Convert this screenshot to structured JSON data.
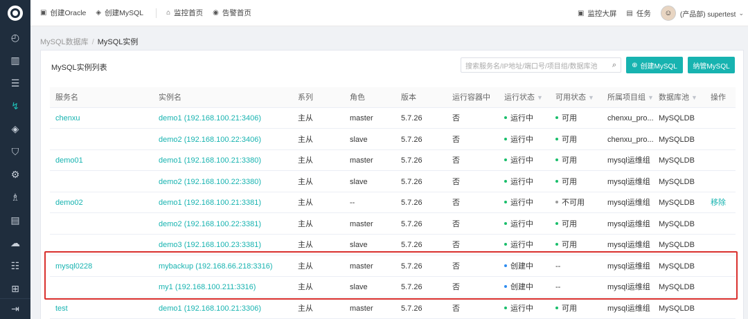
{
  "sidebar": {
    "items": [
      {
        "icon": "dashboard-icon",
        "glyph": "◴"
      },
      {
        "icon": "bar-chart-icon",
        "glyph": "▥"
      },
      {
        "icon": "database-icon",
        "glyph": "☰"
      },
      {
        "icon": "dolphin-icon",
        "glyph": "↯"
      },
      {
        "icon": "layers-icon",
        "glyph": "◈"
      },
      {
        "icon": "shield-icon",
        "glyph": "⛉"
      },
      {
        "icon": "gear-cluster-icon",
        "glyph": "⚙"
      },
      {
        "icon": "people-icon",
        "glyph": "♗"
      },
      {
        "icon": "server-icon",
        "glyph": "▤"
      },
      {
        "icon": "cloud-icon",
        "glyph": "☁"
      },
      {
        "icon": "list-icon",
        "glyph": "☷"
      },
      {
        "icon": "network-icon",
        "glyph": "⊞"
      }
    ],
    "active_index": 3,
    "bottom_icon": "logout-icon",
    "bottom_glyph": "⇥"
  },
  "topbar": {
    "create_oracle": "创建Oracle",
    "create_mysql": "创建MySQL",
    "monitor_home": "监控首页",
    "alert_home": "告警首页",
    "big_screen": "监控大屏",
    "tasks": "任务",
    "user": "(产品部) supertest"
  },
  "breadcrumb": {
    "parent": "MySQL数据库",
    "separator": "/",
    "current": "MySQL实例"
  },
  "card": {
    "title": "MySQL实例列表",
    "search_placeholder": "搜索服务名/IP地址/端口号/项目组/数据库池",
    "create_button": "创建MySQL",
    "manage_button": "纳管MySQL"
  },
  "table": {
    "headers": {
      "service": "服务名",
      "instance": "实例名",
      "series": "系列",
      "role": "角色",
      "version": "版本",
      "in_container": "运行容器中",
      "run_status": "运行状态",
      "avail_status": "可用状态",
      "project_group": "所属项目组",
      "db_pool": "数据库池",
      "action": "操作"
    },
    "rows": [
      {
        "service": "chenxu",
        "instance": "demo1 (192.168.100.21:3406)",
        "series": "主从",
        "role": "master",
        "version": "5.7.26",
        "in_container": "否",
        "run_status": "运行中",
        "avail_status": "可用",
        "project_group": "chenxu_pro...",
        "db_pool": "MySQLDB",
        "action": ""
      },
      {
        "service": "",
        "instance": "demo2 (192.168.100.22:3406)",
        "series": "主从",
        "role": "slave",
        "version": "5.7.26",
        "in_container": "否",
        "run_status": "运行中",
        "avail_status": "可用",
        "project_group": "chenxu_pro...",
        "db_pool": "MySQLDB",
        "action": ""
      },
      {
        "service": "demo01",
        "instance": "demo1 (192.168.100.21:3380)",
        "series": "主从",
        "role": "master",
        "version": "5.7.26",
        "in_container": "否",
        "run_status": "运行中",
        "avail_status": "可用",
        "project_group": "mysql运维组",
        "db_pool": "MySQLDB",
        "action": ""
      },
      {
        "service": "",
        "instance": "demo2 (192.168.100.22:3380)",
        "series": "主从",
        "role": "slave",
        "version": "5.7.26",
        "in_container": "否",
        "run_status": "运行中",
        "avail_status": "可用",
        "project_group": "mysql运维组",
        "db_pool": "MySQLDB",
        "action": ""
      },
      {
        "service": "demo02",
        "instance": "demo1 (192.168.100.21:3381)",
        "series": "主从",
        "role": "--",
        "version": "5.7.26",
        "in_container": "否",
        "run_status": "运行中",
        "avail_status": "不可用",
        "project_group": "mysql运维组",
        "db_pool": "MySQLDB",
        "action": "移除"
      },
      {
        "service": "",
        "instance": "demo2 (192.168.100.22:3381)",
        "series": "主从",
        "role": "master",
        "version": "5.7.26",
        "in_container": "否",
        "run_status": "运行中",
        "avail_status": "可用",
        "project_group": "mysql运维组",
        "db_pool": "MySQLDB",
        "action": ""
      },
      {
        "service": "",
        "instance": "demo3 (192.168.100.23:3381)",
        "series": "主从",
        "role": "slave",
        "version": "5.7.26",
        "in_container": "否",
        "run_status": "运行中",
        "avail_status": "可用",
        "project_group": "mysql运维组",
        "db_pool": "MySQLDB",
        "action": ""
      },
      {
        "service": "mysql0228",
        "instance": "mybackup (192.168.66.218:3316)",
        "series": "主从",
        "role": "master",
        "version": "5.7.26",
        "in_container": "否",
        "run_status": "创建中",
        "avail_status": "--",
        "project_group": "mysql运维组",
        "db_pool": "MySQLDB",
        "action": ""
      },
      {
        "service": "",
        "instance": "my1 (192.168.100.211:3316)",
        "series": "主从",
        "role": "slave",
        "version": "5.7.26",
        "in_container": "否",
        "run_status": "创建中",
        "avail_status": "--",
        "project_group": "mysql运维组",
        "db_pool": "MySQLDB",
        "action": ""
      },
      {
        "service": "test",
        "instance": "demo1 (192.168.100.21:3306)",
        "series": "主从",
        "role": "master",
        "version": "5.7.26",
        "in_container": "否",
        "run_status": "运行中",
        "avail_status": "可用",
        "project_group": "mysql运维组",
        "db_pool": "MySQLDB",
        "action": ""
      }
    ]
  },
  "colors": {
    "accent": "#17b3b0",
    "running": "#19be6b",
    "creating": "#2d8cf0",
    "unavailable": "#999999",
    "highlight_border": "#d9302d"
  }
}
